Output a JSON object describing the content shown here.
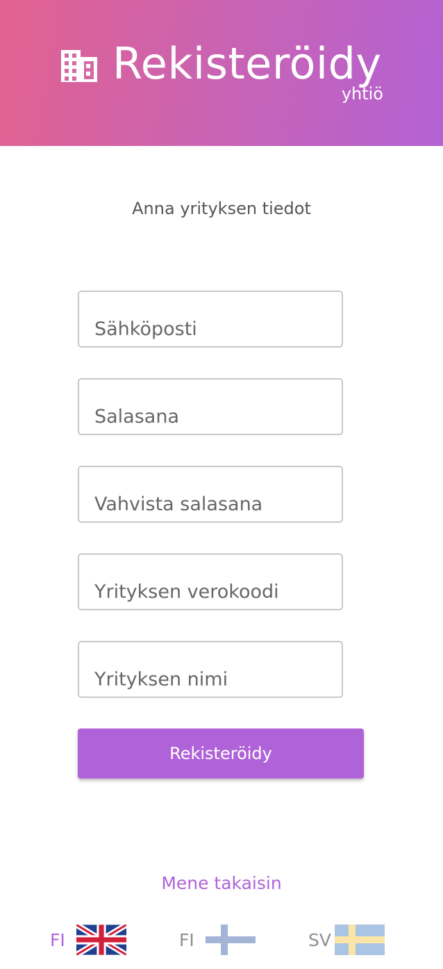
{
  "header": {
    "title": "Rekisteröidy",
    "subtitle": "yhtiö",
    "icon": "building-icon",
    "gradient": [
      "#e2628f",
      "#b362d4"
    ]
  },
  "intro": "Anna yrityksen tiedot",
  "form": {
    "email_placeholder": "Sähköposti",
    "password_placeholder": "Salasana",
    "confirm_placeholder": "Vahvista salasana",
    "tax_code_placeholder": "Yrityksen verokoodi",
    "company_name_placeholder": "Yrityksen nimi",
    "submit_label": "Rekisteröidy"
  },
  "back_link": "Mene takaisin",
  "languages": [
    {
      "code": "FI",
      "flag": "uk-flag-icon",
      "active": true
    },
    {
      "code": "FI",
      "flag": "finland-flag-icon",
      "active": false
    },
    {
      "code": "SV",
      "flag": "sweden-flag-icon",
      "active": false
    }
  ],
  "colors": {
    "accent": "#b063d8",
    "text": "#555555",
    "border": "#c8c8c8"
  }
}
